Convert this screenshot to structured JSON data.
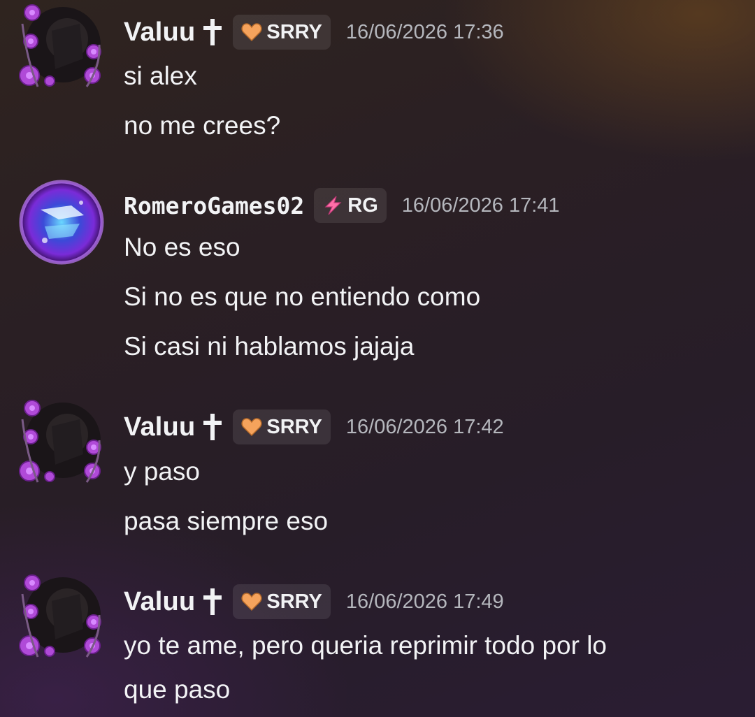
{
  "messages": [
    {
      "username": "Valuu",
      "tag": "SRRY",
      "timestamp": "16/06/2026 17:36",
      "lines": [
        "si alex",
        "no me crees?"
      ]
    },
    {
      "username": "RomeroGames02",
      "tag": "RG",
      "timestamp": "16/06/2026 17:41",
      "lines": [
        "No es eso",
        "Si no es que no entiendo como",
        "Si casi ni hablamos jajaja"
      ]
    },
    {
      "username": "Valuu",
      "tag": "SRRY",
      "timestamp": "16/06/2026 17:42",
      "lines": [
        "y paso",
        "pasa siempre eso"
      ]
    },
    {
      "username": "Valuu",
      "tag": "SRRY",
      "timestamp": "16/06/2026 17:49",
      "lines": [
        "yo te ame, pero queria reprimir todo por lo",
        "que paso"
      ]
    }
  ],
  "icons": {
    "cross": "latin-cross-icon",
    "heart": "orange-heart-icon",
    "lightning": "lightning-bolt-icon",
    "avatar_valuu": "rose-frame-avatar",
    "avatar_romero": "galaxy-avatar"
  },
  "colors": {
    "text": "#f2f3f5",
    "timestamp": "#b5b7bd",
    "heart": "#f5a35c",
    "lightning": "#ff6fa8"
  }
}
